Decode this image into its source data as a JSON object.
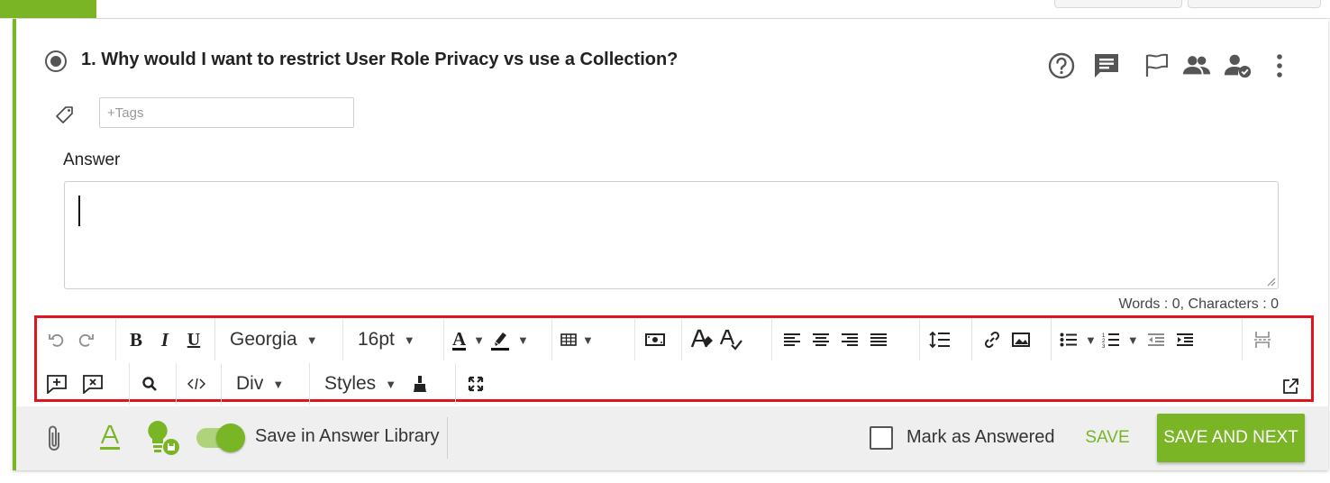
{
  "question": {
    "title": "1. Why would I want to restrict User Role Privacy vs use a Collection?"
  },
  "header_icons": [
    "help-icon",
    "comment-icon",
    "flag-icon",
    "users-icon",
    "user-check-icon",
    "more-vert-icon"
  ],
  "tags": {
    "placeholder": "+Tags",
    "value": ""
  },
  "answer": {
    "label": "Answer",
    "value": "",
    "counts": "Words : 0, Characters : 0"
  },
  "toolbar": {
    "font_family": "Georgia",
    "font_size": "16pt",
    "bold": "B",
    "italic": "I",
    "underline": "U",
    "text_color_glyph": "A",
    "format_block": "Div",
    "styles": "Styles"
  },
  "footer": {
    "save_in_library_label": "Save in Answer Library",
    "save_in_library_on": true,
    "mark_answered_label": "Mark as Answered",
    "mark_answered_checked": false,
    "save_label": "SAVE",
    "save_next_label": "SAVE AND NEXT"
  },
  "colors": {
    "brand_green": "#7ab526",
    "highlight_red": "#e0141c"
  }
}
